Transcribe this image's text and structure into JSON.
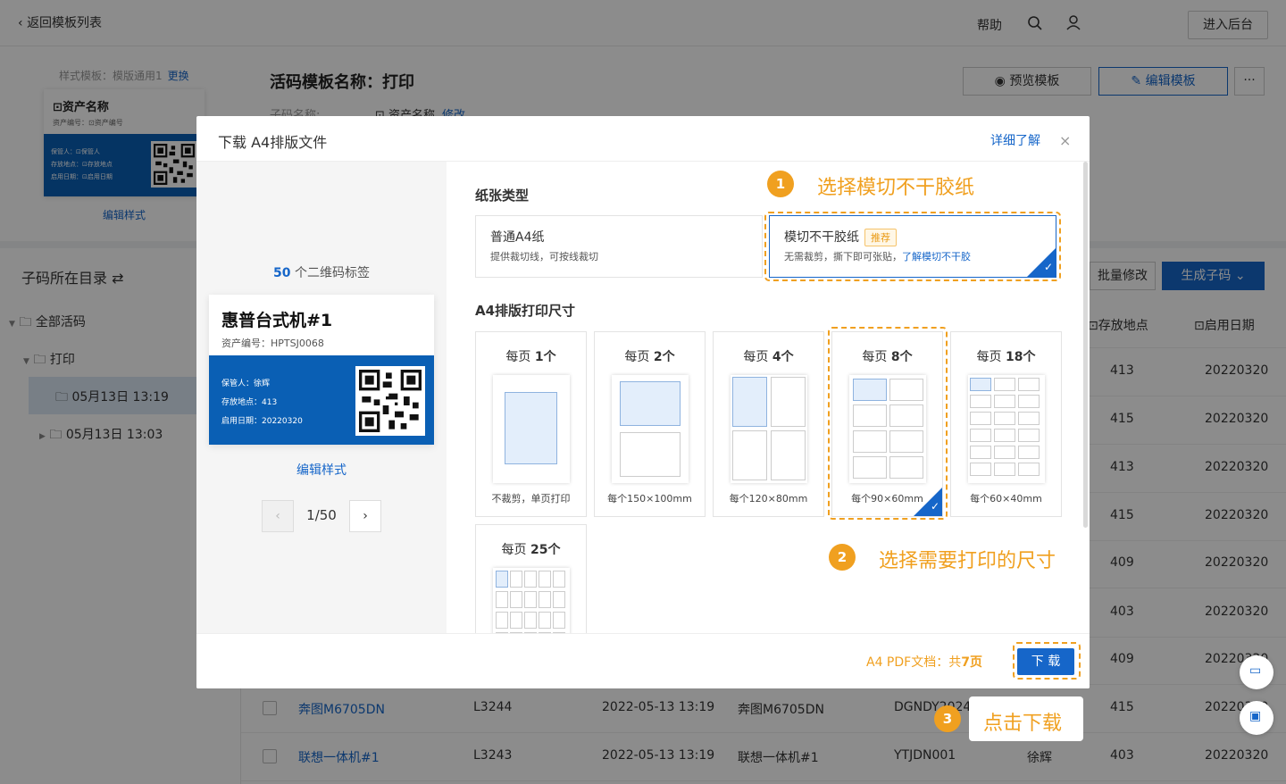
{
  "topbar": {
    "back": "返回模板列表",
    "help": "帮助",
    "admin": "进入后台"
  },
  "template": {
    "style_label": "样式模板：模版通用1",
    "change": "更换",
    "mini_card": {
      "title": "⊡资产名称",
      "sub": "资产编号：⊡资产编号",
      "l1": "保管人：⊡保管人",
      "l2": "存放地点：⊡存放地点",
      "l3": "启用日期：⊡启用日期"
    },
    "edit_style": "编辑样式",
    "name": "活码模板名称：打印",
    "sub_label": "子码名称:",
    "sub_value": "⊡ 资产名称",
    "modify": "修改",
    "preview": "预览模板",
    "edit": "编辑模板",
    "more": "···"
  },
  "left_nav": {
    "title": "子码所在目录",
    "items": [
      "全部活码",
      "打印",
      "05月13日 13:19",
      "05月13日 13:03"
    ]
  },
  "table": {
    "batch": "批量修改",
    "generate": "生成子码",
    "headers": [
      "⊡存放地点",
      "⊡启用日期"
    ],
    "col_loc": [
      "413",
      "415",
      "413",
      "415",
      "409",
      "403",
      "409",
      "415",
      "403"
    ],
    "col_date": [
      "20220320",
      "20220320",
      "20220320",
      "20220320",
      "20220320",
      "20220320",
      "20220320",
      "20220320",
      "20220320"
    ],
    "rows": [
      {
        "name": "奔图M6705DN",
        "code": "L3244",
        "time": "2022-05-13 13:19",
        "asset": "奔图M6705DN",
        "num": "DGNDY2024",
        "keeper": ""
      },
      {
        "name": "联想一体机#1",
        "code": "L3243",
        "time": "2022-05-13 13:19",
        "asset": "联想一体机#1",
        "num": "YTJDN001",
        "keeper": "徐辉"
      }
    ]
  },
  "modal": {
    "title": "下载 A4排版文件",
    "detail": "详细了解",
    "close": "×",
    "count_num": "50",
    "count_text": " 个二维码标签",
    "card": {
      "title": "惠普台式机#1",
      "sub": "资产编号：HPTSJ0068",
      "l1": "保管人：徐辉",
      "l2": "存放地点：413",
      "l3": "启用日期：20220320"
    },
    "edit_style": "编辑样式",
    "page": "1/50",
    "paper_type_title": "纸张类型",
    "paper_types": [
      {
        "name": "普通A4纸",
        "desc": "提供裁切线，可按线裁切"
      },
      {
        "name": "模切不干胶纸",
        "tag": "推荐",
        "desc": "无需裁剪，撕下即可张贴，",
        "link": "了解模切不干胶"
      }
    ],
    "size_title": "A4排版打印尺寸",
    "sizes": [
      {
        "pre": "每页 ",
        "num": "1个",
        "cap": "不裁剪，单页打印"
      },
      {
        "pre": "每页 ",
        "num": "2个",
        "cap": "每个150×100mm"
      },
      {
        "pre": "每页 ",
        "num": "4个",
        "cap": "每个120×80mm"
      },
      {
        "pre": "每页 ",
        "num": "8个",
        "cap": "每个90×60mm"
      },
      {
        "pre": "每页 ",
        "num": "18个",
        "cap": "每个60×40mm"
      },
      {
        "pre": "每页 ",
        "num": "25个",
        "cap": ""
      }
    ],
    "pdf_label": "A4 PDF文档：共",
    "pdf_pages": "7页",
    "download": "下 载"
  },
  "annotations": [
    {
      "num": "1",
      "text": "选择模切不干胶纸"
    },
    {
      "num": "2",
      "text": "选择需要打印的尺寸"
    },
    {
      "num": "3",
      "text": "点击下载"
    }
  ],
  "colors": {
    "primary": "#1666c9",
    "accent": "#f0a020",
    "card_band": "#0a5fb4"
  }
}
